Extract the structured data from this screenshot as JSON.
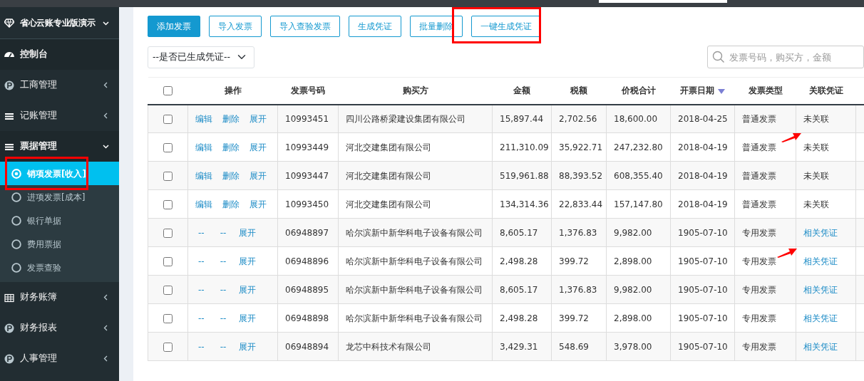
{
  "sidebar": {
    "brand": {
      "label": "省心云账专业版演示",
      "expanded": true
    },
    "items": [
      {
        "label": "控制台",
        "kind": "link"
      },
      {
        "label": "工商管理",
        "kind": "menu",
        "expanded": false
      },
      {
        "label": "记账管理",
        "kind": "menu",
        "expanded": false
      },
      {
        "label": "票据管理",
        "kind": "menu",
        "expanded": true,
        "children": [
          {
            "label": "销项发票[收入]",
            "selected": true
          },
          {
            "label": "进项发票[成本]",
            "selected": false
          },
          {
            "label": "银行单据",
            "selected": false
          },
          {
            "label": "费用票据",
            "selected": false
          },
          {
            "label": "发票查验",
            "selected": false
          }
        ]
      },
      {
        "label": "财务账簿",
        "kind": "menu",
        "expanded": false
      },
      {
        "label": "财务报表",
        "kind": "menu",
        "expanded": false
      },
      {
        "label": "人事管理",
        "kind": "menu",
        "expanded": false
      }
    ]
  },
  "toolbar": {
    "buttons": [
      {
        "label": "添加发票",
        "kind": "primary"
      },
      {
        "label": "导入发票",
        "kind": "outline"
      },
      {
        "label": "导入查验发票",
        "kind": "outline"
      },
      {
        "label": "生成凭证",
        "kind": "outline"
      },
      {
        "label": "批量删除",
        "kind": "outline"
      },
      {
        "label": "一键生成凭证",
        "kind": "outline"
      }
    ]
  },
  "filter": {
    "value": "--是否已生成凭证--"
  },
  "search": {
    "placeholder": "发票号码，购买方，金额"
  },
  "table": {
    "select_all_checked": false,
    "columns": [
      "操作",
      "发票号码",
      "购买方",
      "金额",
      "税额",
      "价税合计",
      "开票日期",
      "发票类型",
      "关联凭证"
    ],
    "rows": [
      {
        "checked": false,
        "actions": [
          {
            "label": "编辑",
            "kind": "link"
          },
          {
            "label": "删除",
            "kind": "link"
          },
          {
            "label": "展开",
            "kind": "link"
          }
        ],
        "number": "10993451",
        "buyer": "四川公路桥梁建设集团有限公司",
        "amount": "15,897.44",
        "tax": "2,702.56",
        "total": "18,600.00",
        "date": "2018-04-25",
        "type": "普通发票",
        "voucher": {
          "text": "未关联",
          "linked": false
        }
      },
      {
        "checked": false,
        "actions": [
          {
            "label": "编辑",
            "kind": "link"
          },
          {
            "label": "删除",
            "kind": "link"
          },
          {
            "label": "展开",
            "kind": "link"
          }
        ],
        "number": "10993449",
        "buyer": "河北交建集团有限公司",
        "amount": "211,310.09",
        "tax": "35,922.71",
        "total": "247,232.80",
        "date": "2018-04-19",
        "type": "普通发票",
        "voucher": {
          "text": "未关联",
          "linked": false
        }
      },
      {
        "checked": false,
        "actions": [
          {
            "label": "编辑",
            "kind": "link"
          },
          {
            "label": "删除",
            "kind": "link"
          },
          {
            "label": "展开",
            "kind": "link"
          }
        ],
        "number": "10993447",
        "buyer": "河北交建集团有限公司",
        "amount": "519,961.88",
        "tax": "88,393.52",
        "total": "608,355.40",
        "date": "2018-04-19",
        "type": "普通发票",
        "voucher": {
          "text": "未关联",
          "linked": false
        }
      },
      {
        "checked": false,
        "actions": [
          {
            "label": "编辑",
            "kind": "link"
          },
          {
            "label": "删除",
            "kind": "link"
          },
          {
            "label": "展开",
            "kind": "link"
          }
        ],
        "number": "10993450",
        "buyer": "河北交建集团有限公司",
        "amount": "134,314.36",
        "tax": "22,833.44",
        "total": "157,147.80",
        "date": "2018-04-19",
        "type": "普通发票",
        "voucher": {
          "text": "未关联",
          "linked": false
        }
      },
      {
        "checked": false,
        "actions": [
          {
            "label": "--",
            "kind": "dash"
          },
          {
            "label": "--",
            "kind": "dash"
          },
          {
            "label": "展开",
            "kind": "link"
          }
        ],
        "number": "06948897",
        "buyer": "哈尔滨新中新华科电子设备有限公司",
        "amount": "8,605.17",
        "tax": "1,376.83",
        "total": "9,982.00",
        "date": "1905-07-10",
        "type": "专用发票",
        "voucher": {
          "text": "相关凭证",
          "linked": true
        }
      },
      {
        "checked": false,
        "actions": [
          {
            "label": "--",
            "kind": "dash"
          },
          {
            "label": "--",
            "kind": "dash"
          },
          {
            "label": "展开",
            "kind": "link"
          }
        ],
        "number": "06948896",
        "buyer": "哈尔滨新中新华科电子设备有限公司",
        "amount": "2,498.28",
        "tax": "399.72",
        "total": "2,898.00",
        "date": "1905-07-10",
        "type": "专用发票",
        "voucher": {
          "text": "相关凭证",
          "linked": true
        }
      },
      {
        "checked": false,
        "actions": [
          {
            "label": "--",
            "kind": "dash"
          },
          {
            "label": "--",
            "kind": "dash"
          },
          {
            "label": "展开",
            "kind": "link"
          }
        ],
        "number": "06948895",
        "buyer": "哈尔滨新中新华科电子设备有限公司",
        "amount": "8,605.17",
        "tax": "1,376.83",
        "total": "9,982.00",
        "date": "1905-07-10",
        "type": "专用发票",
        "voucher": {
          "text": "相关凭证",
          "linked": true
        }
      },
      {
        "checked": false,
        "actions": [
          {
            "label": "--",
            "kind": "dash"
          },
          {
            "label": "--",
            "kind": "dash"
          },
          {
            "label": "展开",
            "kind": "link"
          }
        ],
        "number": "06948898",
        "buyer": "哈尔滨新中新华科电子设备有限公司",
        "amount": "2,498.28",
        "tax": "399.72",
        "total": "2,898.00",
        "date": "1905-07-10",
        "type": "专用发票",
        "voucher": {
          "text": "相关凭证",
          "linked": true
        }
      },
      {
        "checked": false,
        "actions": [
          {
            "label": "--",
            "kind": "dash"
          },
          {
            "label": "--",
            "kind": "dash"
          },
          {
            "label": "展开",
            "kind": "link"
          }
        ],
        "number": "06948894",
        "buyer": "龙芯中科技术有限公司",
        "amount": "3,429.31",
        "tax": "548.69",
        "total": "3,978.00",
        "date": "1905-07-10",
        "type": "专用发票",
        "voucher": {
          "text": "相关凭证",
          "linked": true
        }
      }
    ]
  }
}
